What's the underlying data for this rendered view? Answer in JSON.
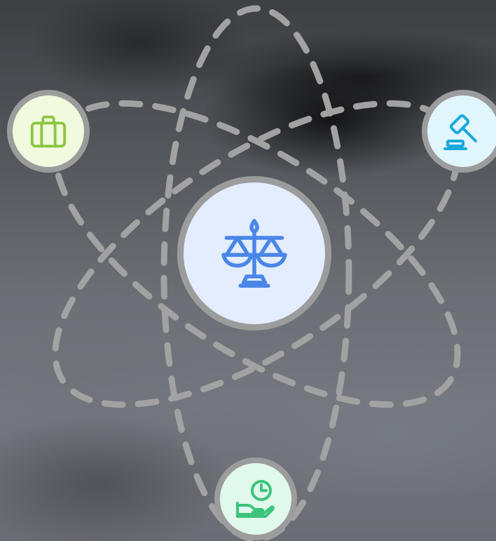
{
  "colors": {
    "orbit_stroke": "#a2a2a2",
    "node_border": "#9c9c9c"
  },
  "nodes": {
    "center": {
      "icon": "balance-scale-icon",
      "fill": "#e3edfd",
      "icon_color": "#4a86e8"
    },
    "left": {
      "icon": "briefcase-icon",
      "fill": "#f1f9df",
      "icon_color": "#8cc63f"
    },
    "right": {
      "icon": "gavel-icon",
      "fill": "#e0f5fc",
      "icon_color": "#1aa8dd"
    },
    "bottom": {
      "icon": "hand-clock-icon",
      "fill": "#e1f8ec",
      "icon_color": "#3cc47c"
    }
  }
}
